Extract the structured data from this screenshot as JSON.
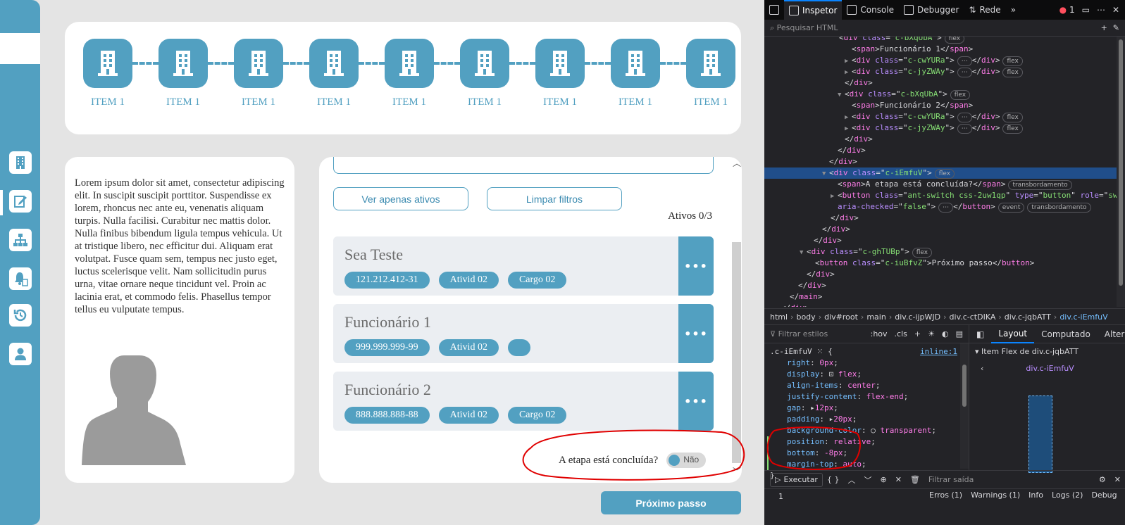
{
  "colors": {
    "brand": "#52a0c1",
    "background": "#e4e4e4",
    "card": "#ffffff",
    "devtools_bg": "#232327",
    "annotation": "#e00000"
  },
  "sidebar": {
    "items": [
      {
        "icon": "building-icon"
      },
      {
        "icon": "edit-icon"
      },
      {
        "icon": "org-chart-icon"
      },
      {
        "icon": "bell-doc-icon"
      },
      {
        "icon": "history-icon"
      },
      {
        "icon": "user-icon"
      }
    ]
  },
  "stepper": {
    "steps": [
      {
        "label": "ITEM 1"
      },
      {
        "label": "ITEM 1"
      },
      {
        "label": "ITEM 1"
      },
      {
        "label": "ITEM 1"
      },
      {
        "label": "ITEM 1"
      },
      {
        "label": "ITEM 1"
      },
      {
        "label": "ITEM 1"
      },
      {
        "label": "ITEM 1"
      },
      {
        "label": "ITEM 1"
      }
    ]
  },
  "info": {
    "text": "Lorem ipsum dolor sit amet, consectetur adipiscing elit. In suscipit suscipit porttitor. Suspendisse ex lorem, rhoncus nec ante eu, venenatis aliquam turpis. Nulla facilisi. Curabitur nec mattis dolor. Nulla finibus bibendum ligula tempus vehicula. Ut at tristique libero, nec efficitur dui. Aliquam erat volutpat. Fusce quam sem, tempus nec justo eget, luctus scelerisque velit. Nam sollicitudin purus urna, vitae ornare neque tincidunt vel. Proin ac lacinia erat, et commodo felis. Phasellus tempor tellus eu vulputate tempus."
  },
  "list": {
    "filter_active": "Ver apenas ativos",
    "filter_clear": "Limpar filtros",
    "ativos": "Ativos 0/3",
    "employees": [
      {
        "name": "Sea Teste",
        "chips": [
          "121.212.412-31",
          "Ativid 02",
          "Cargo 02"
        ]
      },
      {
        "name": "Funcionário 1",
        "chips": [
          "999.999.999-99",
          "Ativid 02",
          ""
        ]
      },
      {
        "name": "Funcionário 2",
        "chips": [
          "888.888.888-88",
          "Ativid 02",
          "Cargo 02"
        ]
      }
    ],
    "more": "•••",
    "etapa_label": "A etapa está concluída?",
    "switch_text": "Não",
    "switch_checked": false
  },
  "next_button": "Próximo passo",
  "devtools": {
    "tabs": [
      "Inspetor",
      "Console",
      "Debugger",
      "Rede"
    ],
    "error_count": "1",
    "search_placeholder": "Pesquisar HTML",
    "tree": {
      "l0_tag": "div",
      "l0_attr": "class",
      "l0_val": "c-bXqUbA",
      "l1": "Funcionário 1",
      "l2_val": "c-cwYURa",
      "l3_val": "c-jyZWAy",
      "l5_val": "c-bXqUbA",
      "l6": "Funcionário 2",
      "l7_val": "c-cwYURa",
      "l8_val": "c-jyZWAy",
      "sel_val": "c-iEmfuV",
      "span_text": "A etapa está concluída?",
      "btn_class": "ant-switch css-2uw1qp",
      "btn_type": "button",
      "btn_role": "switch",
      "btn_aria": "false",
      "gh_val": "c-ghTUBp",
      "next_class": "c-iuBfvZ",
      "next_text": "Próximo passo",
      "badge_flex": "flex",
      "badge_overflow": "transbordamento",
      "badge_event": "event"
    },
    "breadcrumbs": [
      "html",
      "body",
      "div#root",
      "main",
      "div.c-ijpWJD",
      "div.c-ctDIKA",
      "div.c-jqbATT",
      "div.c-iEmfuV"
    ],
    "rules_filter": "Filtrar estilos",
    "rules_opts": [
      ":hov",
      ".cls"
    ],
    "rule_selector": ".c-iEmfuV",
    "rule_source": "inline:1",
    "rule_props": [
      {
        "p": "right",
        "v": "0px"
      },
      {
        "p": "display",
        "v": "flex"
      },
      {
        "p": "align-items",
        "v": "center"
      },
      {
        "p": "justify-content",
        "v": "flex-end"
      },
      {
        "p": "gap",
        "v": "12px"
      },
      {
        "p": "padding",
        "v": "20px"
      },
      {
        "p": "background-color",
        "v": "transparent"
      },
      {
        "p": "position",
        "v": "relative"
      },
      {
        "p": "bottom",
        "v": "-8px"
      },
      {
        "p": "margin-top",
        "v": "auto"
      }
    ],
    "layout_tabs": [
      "Layout",
      "Computado",
      "Altera"
    ],
    "flex_title": "Item Flex de div.c-jqbATT",
    "flex_node": "div.c-iEmfuV",
    "console": {
      "run": "Executar",
      "filter": "Filtrar saída",
      "levels": [
        "Erros (1)",
        "Warnings (1)",
        "Info",
        "Logs (2)",
        "Debug"
      ],
      "line": "1"
    }
  }
}
